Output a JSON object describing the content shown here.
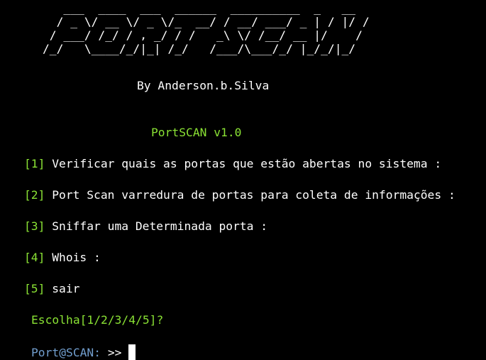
{
  "banner": {
    "ascii_lines": [
      "   ___  ____  ___  ______  __________  _   __",
      "  / _ \\/ __ \\/ _ \\/_  __/ / __/ ___/ _ | / |/ /",
      " / ___/ /_/ / , _/ / /   _\\ \\/ /__/ __ |/    /",
      "/_/   \\____/_/|_| /_/   /___/\\___/_/ |_/_/|_/"
    ],
    "author": "By Anderson.b.Silva"
  },
  "app": {
    "title": "PortSCAN v1.0"
  },
  "menu": {
    "items": [
      {
        "key": "[1]",
        "label": " Verificar quais as portas que estão abertas no sistema :"
      },
      {
        "key": "[2]",
        "label": " Port Scan varredura de portas para coleta de informações :"
      },
      {
        "key": "[3]",
        "label": " Sniffar uma Determinada porta :"
      },
      {
        "key": "[4]",
        "label": " Whois :"
      },
      {
        "key": "[5]",
        "label": " sair"
      }
    ]
  },
  "question": "Escolha[1/2/3/4/5]?",
  "prompt": {
    "name": "Port@SCAN:",
    "arrows": " >> "
  },
  "colors": {
    "background": "#000000",
    "text": "#ffffff",
    "green": "#8ae234",
    "blue": "#729fcf"
  }
}
